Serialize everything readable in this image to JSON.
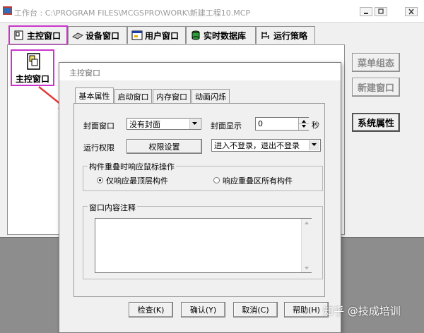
{
  "window": {
    "title": "工作台 : C:\\PROGRAM FILES\\MCGSPRO\\WORK\\新建工程10.MCP",
    "controls": [
      "minimize",
      "restore",
      "close"
    ]
  },
  "tabs": [
    {
      "label": "主控窗口",
      "icon": "main-window-icon",
      "selected": true
    },
    {
      "label": "设备窗口",
      "icon": "device-icon"
    },
    {
      "label": "用户窗口",
      "icon": "user-window-icon"
    },
    {
      "label": "实时数据库",
      "icon": "database-icon"
    },
    {
      "label": "运行策略",
      "icon": "strategy-icon"
    }
  ],
  "content": {
    "item_label": "主控窗口"
  },
  "side_buttons": {
    "menu_config": "菜单组态",
    "new_window": "新建窗口",
    "system_props": "系统属性"
  },
  "dialog": {
    "title": "主控窗口",
    "tabs": [
      "基本属性",
      "启动窗口",
      "内存窗口",
      "动画闪烁"
    ],
    "cover_window_label": "封面窗口",
    "cover_window_value": "没有封面",
    "cover_display_label": "封面显示",
    "cover_display_value": "0",
    "cover_display_unit": "秒",
    "run_permission_label": "运行权限",
    "permission_button": "权限设置",
    "login_value": "进入不登录，退出不登录",
    "overlap_group": "构件重叠时响应鼠标操作",
    "radio_top": "仅响应最顶层构件",
    "radio_all": "响应重叠区所有构件",
    "comment_group": "窗口内容注释",
    "comment_value": "",
    "buttons": {
      "check": "检查(K)",
      "ok": "确认(Y)",
      "cancel": "取消(C)",
      "help": "帮助(H)"
    }
  },
  "watermark": "知乎 @技成培训",
  "colors": {
    "highlight": "#cc33cc",
    "arrow": "#e53935",
    "background": "#8d8d8d"
  }
}
